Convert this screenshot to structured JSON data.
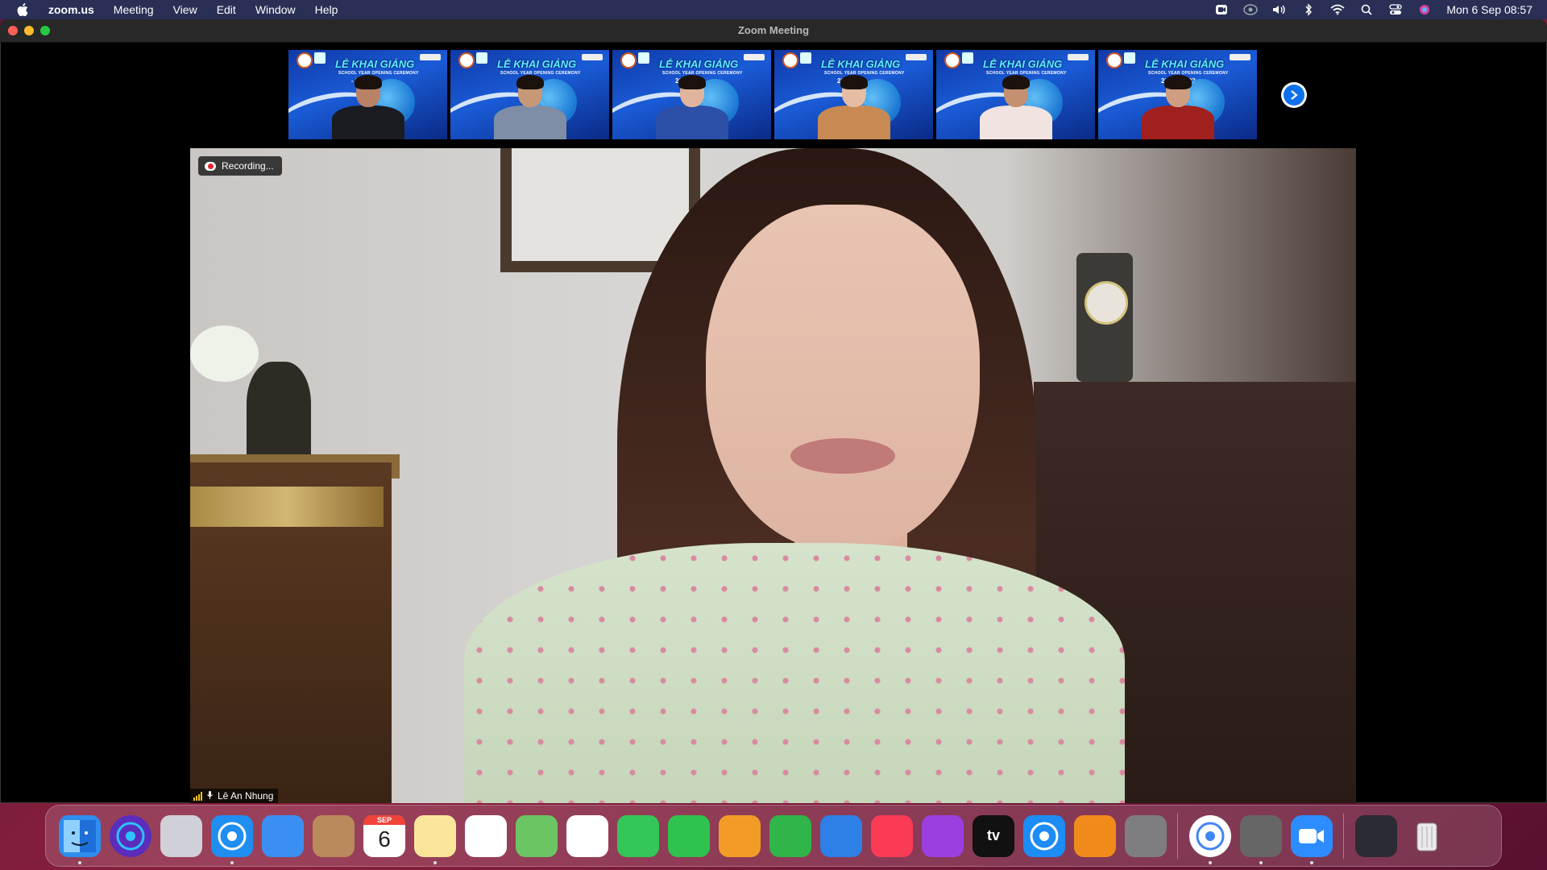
{
  "menubar": {
    "app_name": "zoom.us",
    "items": [
      "Meeting",
      "View",
      "Edit",
      "Window",
      "Help"
    ],
    "clock": "Mon 6 Sep  08:57"
  },
  "window": {
    "title": "Zoom Meeting"
  },
  "thumbnails": [
    {
      "banner": "LỄ KHAI GIẢNG",
      "sub": "SCHOOL YEAR OPENING CEREMONY",
      "year": "- 2022",
      "body_color": "#1b1b22",
      "skin": "#b98266"
    },
    {
      "banner": "LỄ KHAI GIẢNG",
      "sub": "SCHOOL YEAR OPENING CEREMONY",
      "year": "",
      "body_color": "#7f8ea6",
      "skin": "#c79878"
    },
    {
      "banner": "LỄ KHAI GIẢNG",
      "sub": "SCHOOL YEAR OPENING CEREMONY",
      "year": "2022",
      "body_color": "#2c4fa8",
      "skin": "#e0b49c"
    },
    {
      "banner": "LỄ KHAI GIẢNG",
      "sub": "SCHOOL YEAR OPENING CEREMONY",
      "year": "2022",
      "body_color": "#c88a52",
      "skin": "#e4bda3"
    },
    {
      "banner": "LỄ KHAI GIẢNG",
      "sub": "SCHOOL YEAR OPENING CEREMONY",
      "year": "",
      "body_color": "#f1e3df",
      "skin": "#c59070"
    },
    {
      "banner": "LỄ KHAI GIẢNG",
      "sub": "SCHOOL YEAR OPENING CEREMONY",
      "year": "2021 - 2022",
      "body_color": "#a0201e",
      "skin": "#cf9e82"
    }
  ],
  "video": {
    "recording_label": "Recording...",
    "speaker_name": "Lê An Nhung"
  },
  "dock": {
    "calendar_month": "SEP",
    "calendar_day": "6",
    "apps": [
      {
        "name": "finder",
        "color": "#2e8ef0"
      },
      {
        "name": "siri",
        "color": "#5b2dbd"
      },
      {
        "name": "launchpad",
        "color": "#d0d0d8"
      },
      {
        "name": "safari",
        "color": "#1f8ef1"
      },
      {
        "name": "mail",
        "color": "#3b8ff2"
      },
      {
        "name": "contacts",
        "color": "#b98b5c"
      },
      {
        "name": "calendar",
        "color": "#ffffff"
      },
      {
        "name": "notes",
        "color": "#fbe59a"
      },
      {
        "name": "reminders",
        "color": "#ffffff"
      },
      {
        "name": "maps",
        "color": "#6cc563"
      },
      {
        "name": "photos",
        "color": "#ffffff"
      },
      {
        "name": "messages",
        "color": "#35c659"
      },
      {
        "name": "facetime",
        "color": "#2fc24e"
      },
      {
        "name": "pages",
        "color": "#f39b27"
      },
      {
        "name": "numbers",
        "color": "#2fb54a"
      },
      {
        "name": "keynote",
        "color": "#2e7fe6"
      },
      {
        "name": "music",
        "color": "#fa3b55"
      },
      {
        "name": "podcasts",
        "color": "#9b3fe0"
      },
      {
        "name": "apple-tv",
        "color": "#111111"
      },
      {
        "name": "app-store",
        "color": "#1e8cf5"
      },
      {
        "name": "books",
        "color": "#f08a1b"
      },
      {
        "name": "system-preferences",
        "color": "#7d7d82"
      },
      {
        "name": "chrome",
        "color": "#ffffff"
      },
      {
        "name": "screen-capture",
        "color": "#666666"
      },
      {
        "name": "zoom",
        "color": "#2d8cff"
      },
      {
        "name": "zoom-window",
        "color": "#2b2b33"
      },
      {
        "name": "trash",
        "color": "#cfcfd4"
      }
    ],
    "apple_tv_label": "tv"
  },
  "colors": {
    "menubar_bg": "#2a2f55",
    "zoom_blue": "#0e71eb",
    "recording_red": "#e0262c"
  }
}
